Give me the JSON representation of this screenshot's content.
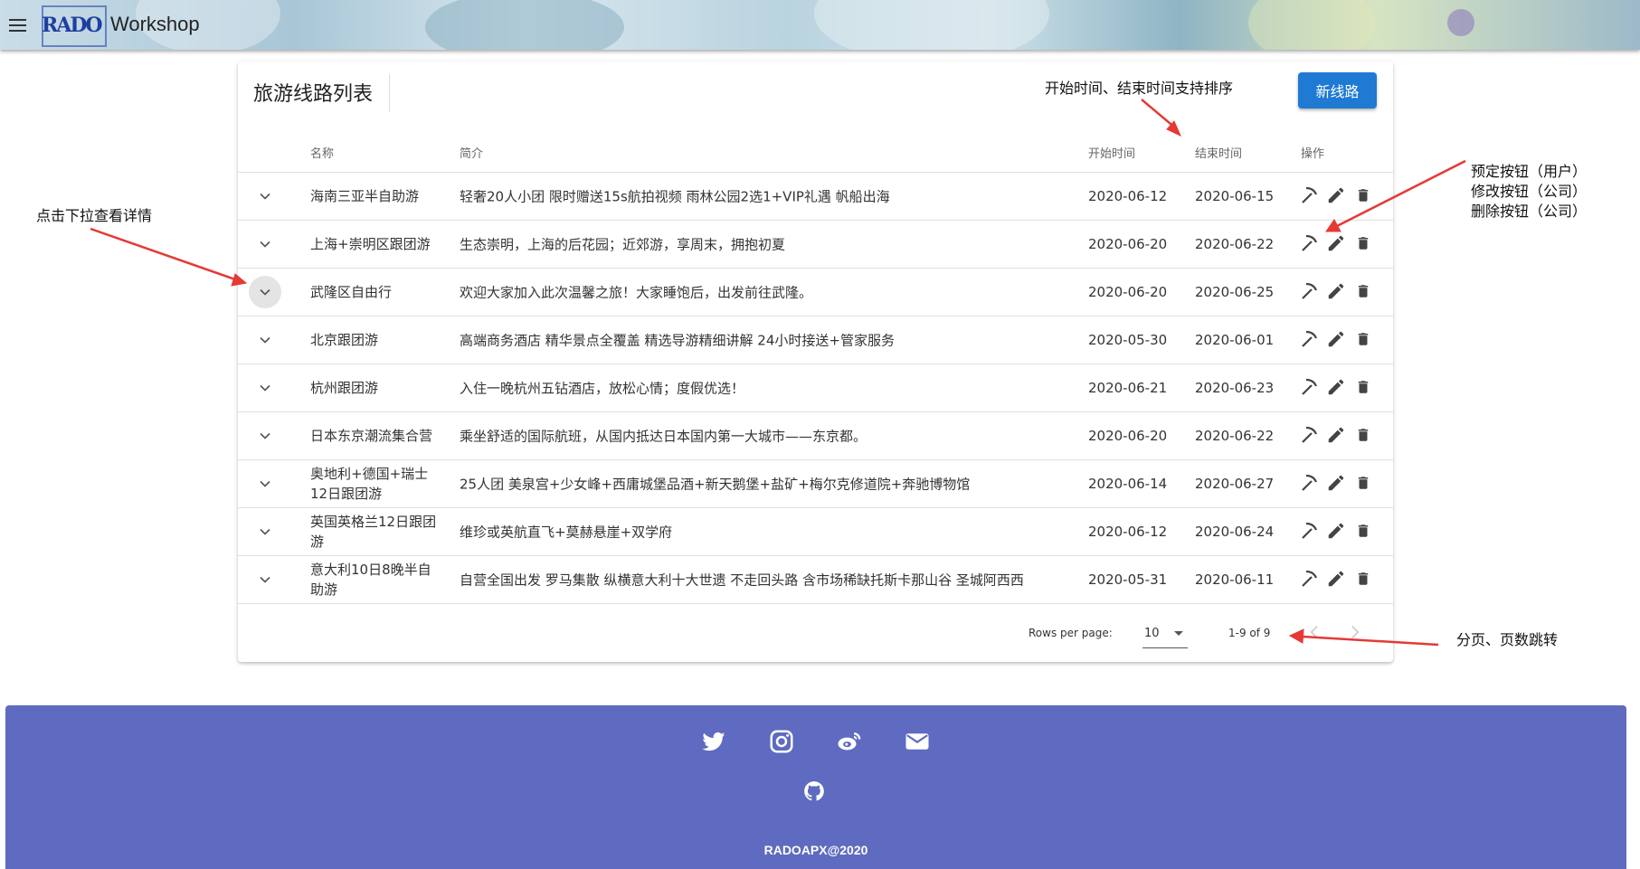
{
  "app": {
    "title": "Workshop",
    "logo_text": "RADO"
  },
  "card": {
    "title": "旅游线路列表",
    "new_button": "新线路",
    "columns": {
      "name": "名称",
      "desc": "简介",
      "start": "开始时间",
      "end": "结束时间",
      "actions": "操作"
    }
  },
  "rows": [
    {
      "name": "海南三亚半自助游",
      "desc": "轻奢20人小团 限时赠送15s航拍视频 雨林公园2选1+VIP礼遇 帆船出海",
      "start": "2020-06-12",
      "end": "2020-06-15"
    },
    {
      "name": "上海+崇明区跟团游",
      "desc": "生态崇明，上海的后花园；近郊游，享周末，拥抱初夏",
      "start": "2020-06-20",
      "end": "2020-06-22"
    },
    {
      "name": "武隆区自由行",
      "desc": "欢迎大家加入此次温馨之旅！大家睡饱后，出发前往武隆。",
      "start": "2020-06-20",
      "end": "2020-06-25"
    },
    {
      "name": "北京跟团游",
      "desc": "高端商务酒店 精华景点全覆盖 精选导游精细讲解 24小时接送+管家服务",
      "start": "2020-05-30",
      "end": "2020-06-01"
    },
    {
      "name": "杭州跟团游",
      "desc": "入住一晚杭州五钻酒店，放松心情；度假优选！",
      "start": "2020-06-21",
      "end": "2020-06-23"
    },
    {
      "name": "日本东京潮流集合营",
      "desc": "乘坐舒适的国际航班，从国内抵达日本国内第一大城市——东京都。",
      "start": "2020-06-20",
      "end": "2020-06-22"
    },
    {
      "name": "奥地利+德国+瑞士12日跟团游",
      "desc": "25人团 美泉宫+少女峰+西庸城堡品酒+新天鹅堡+盐矿+梅尔克修道院+奔驰博物馆",
      "start": "2020-06-14",
      "end": "2020-06-27"
    },
    {
      "name": "英国英格兰12日跟团游",
      "desc": "维珍或英航直飞+莫赫悬崖+双学府",
      "start": "2020-06-12",
      "end": "2020-06-24"
    },
    {
      "name": "意大利10日8晚半自助游",
      "desc": "自营全国出发 罗马集散 纵横意大利十大世遗 不走回头路 含市场稀缺托斯卡那山谷 圣城阿西西",
      "start": "2020-05-31",
      "end": "2020-06-11"
    }
  ],
  "pagination": {
    "rows_per_page_label": "Rows per page:",
    "rows_per_page": "10",
    "info": "1-9 of 9"
  },
  "annotations": {
    "sort": "开始时间、结束时间支持排序",
    "expand": "点击下拉查看详情",
    "book": "预定按钮（用户）",
    "edit": "修改按钮（公司）",
    "delete": "删除按钮（公司）",
    "paging": "分页、页数跳转"
  },
  "footer": {
    "copyright": "RADOAPX@2020",
    "social_icons": [
      "twitter-icon",
      "instagram-icon",
      "weibo-icon",
      "email-icon",
      "github-icon"
    ]
  },
  "colors": {
    "primary_button": "#1e7ad3",
    "footer_bg": "#5e6bc0",
    "arrow": "#e53935"
  }
}
